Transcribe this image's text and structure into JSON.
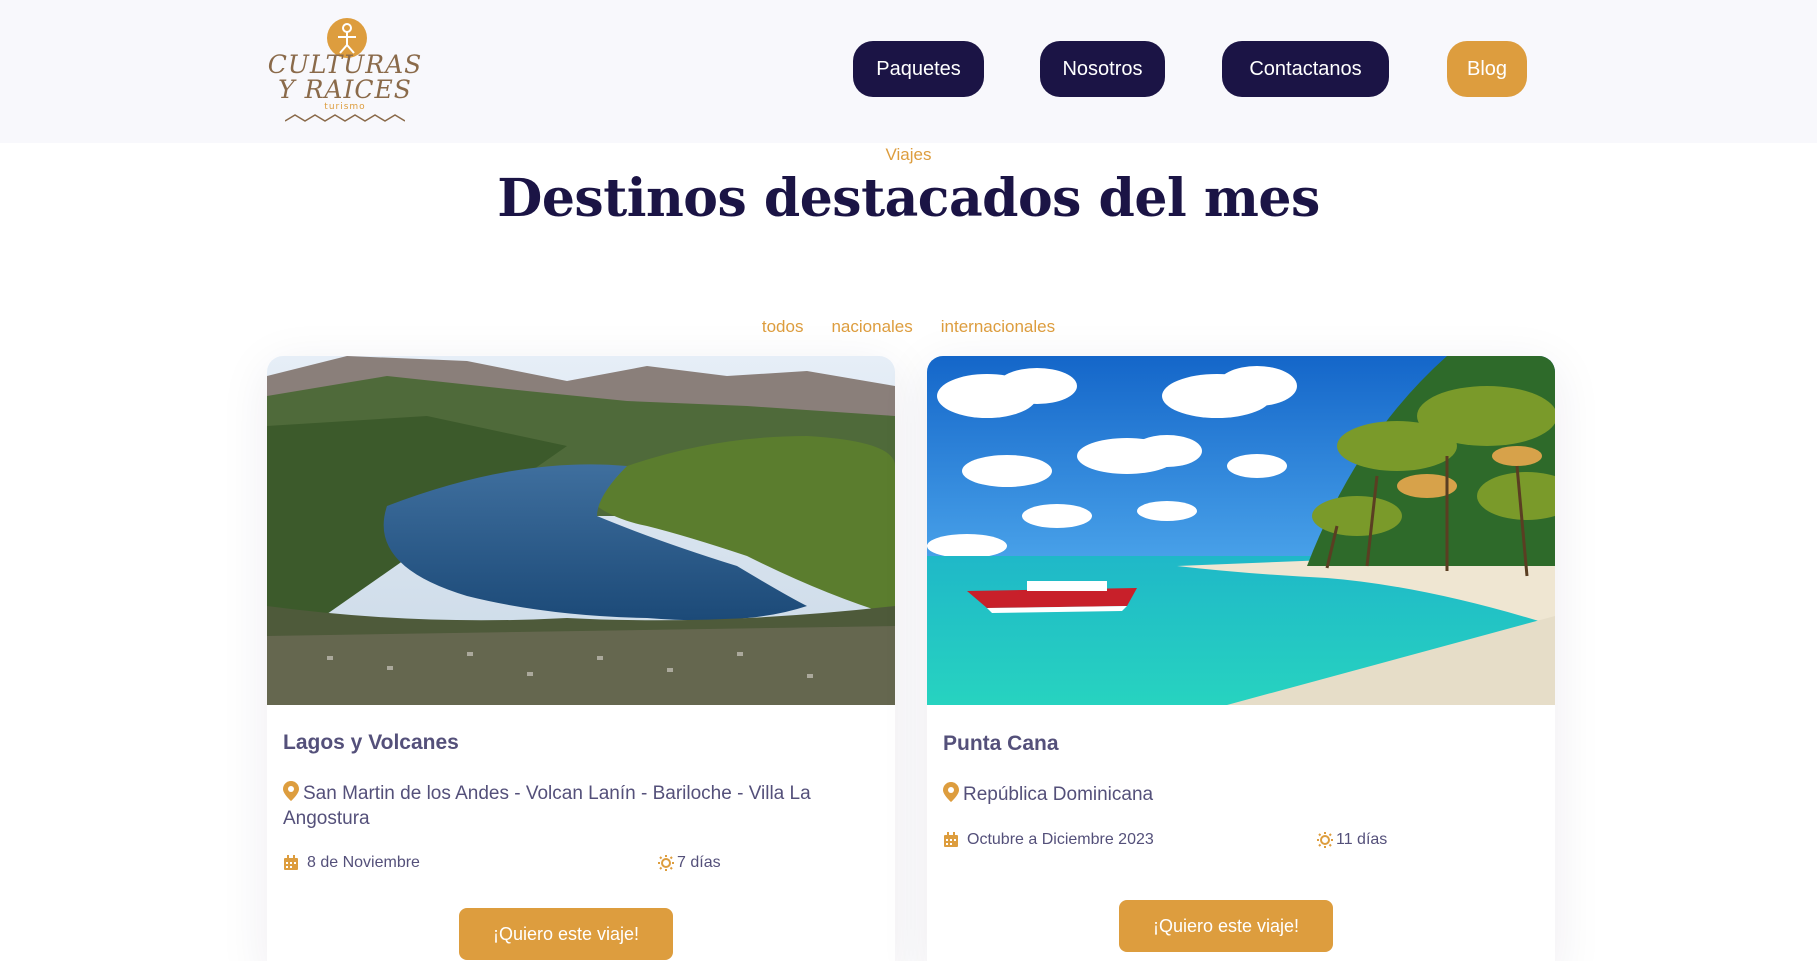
{
  "brand": {
    "line1": "CULTURAS",
    "line2": "Y RAICES",
    "sub": "turismo",
    "accent_color": "#dd9d3e",
    "brown_color": "#8a6a4a"
  },
  "nav": {
    "items": [
      {
        "label": "Paquetes",
        "style": "dark"
      },
      {
        "label": "Nosotros",
        "style": "dark"
      },
      {
        "label": "Contactanos",
        "style": "dark"
      },
      {
        "label": "Blog",
        "style": "gold"
      }
    ],
    "dark_color": "#1b1445"
  },
  "section": {
    "eyebrow": "Viajes",
    "title": "Destinos destacados del mes"
  },
  "filters": [
    "todos",
    "nacionales",
    "internacionales"
  ],
  "cards": [
    {
      "name": "Lagos y Volcanes",
      "location": "San Martin de los Andes - Volcan Lanín - Bariloche - Villa La Angostura",
      "date": "8 de Noviembre",
      "duration": "7 días",
      "cta": "¡Quiero este viaje!",
      "image": "lake-valley-mountains"
    },
    {
      "name": "Punta Cana",
      "location": "República Dominicana",
      "date": "Octubre a Diciembre 2023",
      "duration": "11 días",
      "cta": "¡Quiero este viaje!",
      "image": "tropical-beach-boat"
    }
  ]
}
